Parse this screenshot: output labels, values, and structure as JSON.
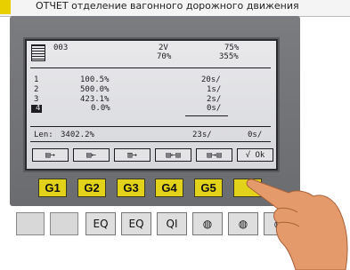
{
  "top_strip": {
    "text": "ОТЧЕТ отделение вагонного дорожного движения"
  },
  "display": {
    "header": {
      "id": "003",
      "mid_top": "2V",
      "mid_bot": "70%",
      "right_top": "75%",
      "right_bot": "355%"
    },
    "rows": [
      {
        "index": "1",
        "pct": "100.5%",
        "count": "20s/"
      },
      {
        "index": "2",
        "pct": "500.0%",
        "count": "1s/"
      },
      {
        "index": "3",
        "pct": "423.1%",
        "count": "2s/"
      },
      {
        "index": "4",
        "pct": "0.0%",
        "count": "0s/"
      }
    ],
    "footer": {
      "len_label": "Len:",
      "len_value": "3402.2%",
      "total": "23s/",
      "zero": "0s/"
    },
    "softkeys": [
      "▤→",
      "▤←",
      "▥→",
      "▤←▤",
      "▤→▤",
      "√ Ok"
    ]
  },
  "function_buttons": [
    "G1",
    "G2",
    "G3",
    "G4",
    "G5",
    ""
  ],
  "bottom_keys": [
    "ꟷ",
    "ꟷ",
    "EQ",
    "EQ",
    "QI",
    "◍",
    "◍",
    "◍"
  ],
  "colors": {
    "device": "#6f7074",
    "lcd": "#e2e3e6",
    "button_yellow": "#e3d21a",
    "hand": "#e49a6a"
  }
}
